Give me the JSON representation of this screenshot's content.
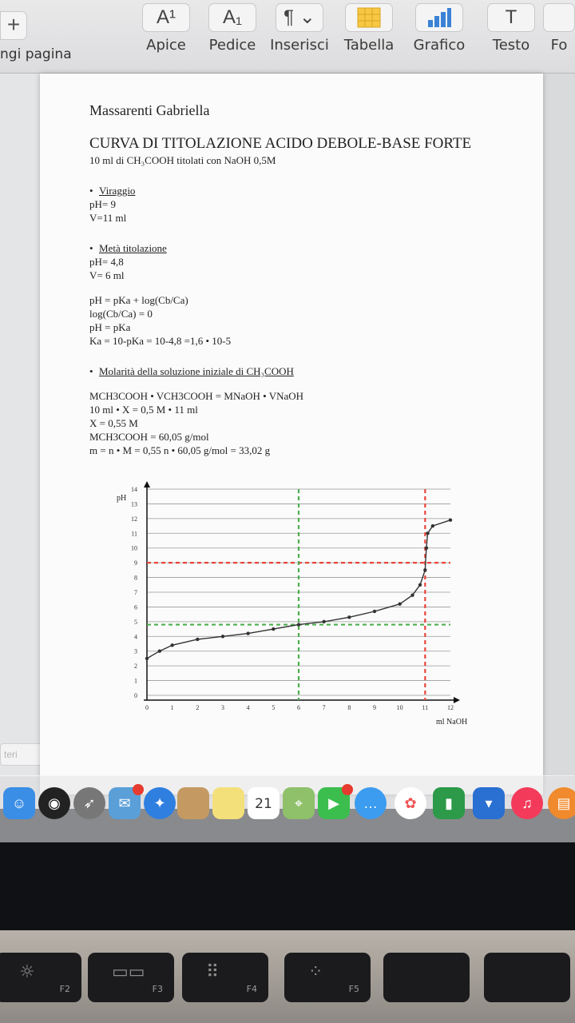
{
  "toolbar": {
    "add_page_label": "ngi pagina",
    "buttons": [
      {
        "name": "apice",
        "label": "Apice",
        "glyph": "A¹"
      },
      {
        "name": "pedice",
        "label": "Pedice",
        "glyph": "A₁"
      },
      {
        "name": "inserisci",
        "label": "Inserisci",
        "glyph": "¶ ⌄"
      },
      {
        "name": "tabella",
        "label": "Tabella",
        "glyph": "table-icon"
      },
      {
        "name": "grafico",
        "label": "Grafico",
        "glyph": "chart-icon"
      },
      {
        "name": "testo",
        "label": "Testo",
        "glyph": "T"
      },
      {
        "name": "forma",
        "label": "Fo",
        "glyph": ""
      }
    ]
  },
  "sidebar": {
    "search_placeholder": "teri"
  },
  "document": {
    "author": "Massarenti Gabriella",
    "title": "CURVA DI TITOLAZIONE ACIDO DEBOLE-BASE FORTE",
    "subtitle": "10 ml di CH₃COOH titolati con NaOH 0,5M",
    "viraggio": {
      "heading": "Viraggio",
      "lines": [
        "pH= 9",
        "V=11 ml"
      ]
    },
    "meta": {
      "heading": "Metà titolazione",
      "lines": [
        "pH= 4,8",
        "V= 6 ml"
      ]
    },
    "formulas": [
      "pH = pKa + log(Cb/Ca)",
      "log(Cb/Ca) = 0",
      "pH = pKa",
      "Ka = 10-pKa = 10-4,8 =1,6 • 10-5"
    ],
    "molarita": {
      "heading": "Molarità della soluzione iniziale di CH₃COOH",
      "lines": [
        "MCH3COOH • VCH3COOH = MNaOH • VNaOH",
        "10 ml • X = 0,5 M • 11 ml",
        "X = 0,55 M",
        "MCH3COOH = 60,05 g/mol",
        "m = n • M = 0,55 n • 60,05 g/mol = 33,02 g"
      ]
    }
  },
  "chart_data": {
    "type": "line",
    "ylabel": "pH",
    "xlabel": "ml NaOH",
    "xlim": [
      0,
      12
    ],
    "ylim": [
      0,
      14
    ],
    "x_ticks": [
      "0",
      "1",
      "2",
      "3",
      "4",
      "5",
      "6",
      "7",
      "8",
      "9",
      "10",
      "11",
      "12"
    ],
    "y_ticks": [
      "0",
      "1",
      "2",
      "3",
      "4",
      "5",
      "6",
      "7",
      "8",
      "9",
      "10",
      "11",
      "12",
      "13",
      "14"
    ],
    "series": [
      {
        "x": [
          0,
          0.5,
          1,
          2,
          3,
          4,
          5,
          6,
          7,
          8,
          9,
          10,
          10.5,
          10.8,
          11,
          11.05,
          11.1,
          11.3,
          12
        ],
        "y": [
          2.5,
          3.0,
          3.4,
          3.8,
          4.0,
          4.2,
          4.5,
          4.8,
          5.0,
          5.3,
          5.7,
          6.2,
          6.8,
          7.5,
          8.5,
          10.0,
          11.0,
          11.5,
          11.9
        ]
      }
    ],
    "reference_lines": [
      {
        "orientation": "horizontal",
        "value": 9,
        "color": "#e8463c"
      },
      {
        "orientation": "horizontal",
        "value": 4.8,
        "color": "#4caf50"
      },
      {
        "orientation": "vertical",
        "value": 11,
        "color": "#e8463c"
      },
      {
        "orientation": "vertical",
        "value": 6,
        "color": "#4caf50"
      }
    ],
    "grid": true
  },
  "dock": {
    "calendar_day": "21",
    "apps": [
      "finder-icon",
      "siri-icon",
      "launchpad-icon",
      "mail-icon",
      "safari-icon",
      "notes-icon",
      "stickies-icon",
      "calendar-icon",
      "maps-icon",
      "facetime-icon",
      "messages-icon",
      "photos-icon",
      "numbers-icon",
      "keynote-icon",
      "music-icon",
      "books-icon"
    ]
  },
  "keyboard": {
    "keys": [
      "F2",
      "F3",
      "F4",
      "F5"
    ]
  }
}
